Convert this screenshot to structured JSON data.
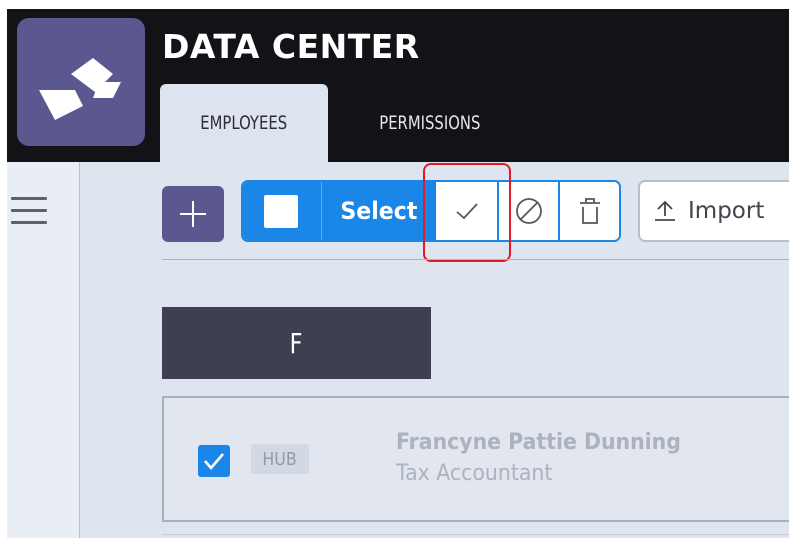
{
  "app": {
    "title": "DATA CENTER"
  },
  "tabs": [
    {
      "label": "EMPLOYEES",
      "active": true
    },
    {
      "label": "PERMISSIONS",
      "active": false
    }
  ],
  "sidebar": {
    "menu_icon": "hamburger-menu-icon"
  },
  "toolbar": {
    "add_icon": "plus-icon",
    "select_label": "Select",
    "select_checkbox_icon": "checkbox-icon",
    "approve_icon": "checkmark-icon",
    "block_icon": "circle-slash-icon",
    "delete_icon": "trash-icon",
    "import_icon": "upload-icon",
    "import_label": "Import"
  },
  "list": {
    "group_letter": "F",
    "rows": [
      {
        "checked": true,
        "tag": "HUB",
        "name": "Francyne Pattie Dunning",
        "job_title": "Tax Accountant"
      }
    ]
  },
  "colors": {
    "topbar": "#121217",
    "brand_purple": "#5b5890",
    "primary_blue": "#1a86e8",
    "highlight_red": "#e01b24",
    "group_header": "#3c4050",
    "main_bg": "#dfe5ef"
  }
}
